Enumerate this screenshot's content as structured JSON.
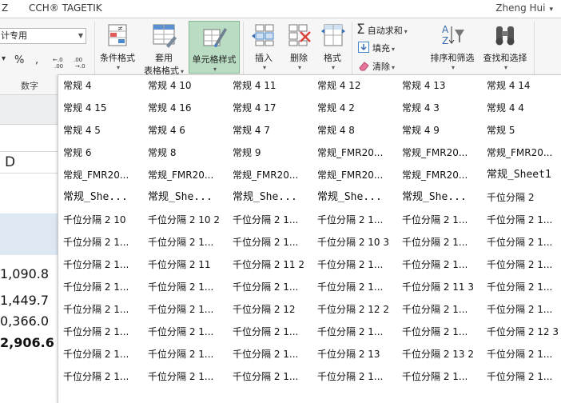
{
  "tabs": [
    "Z",
    "CCH® TAGETIK"
  ],
  "user": {
    "name": "Zheng Hui"
  },
  "ribbon": {
    "number_format_value": "计专用",
    "number_group_label": "数字",
    "number_symbols": {
      "percent": "%",
      "comma": ",",
      "inc_decimal": "←.0 .00",
      "dec_decimal": ".00 →.0"
    },
    "conditional_format": "条件格式",
    "table_format": [
      "套用",
      "表格格式"
    ],
    "cell_styles": "单元格样式",
    "insert": "插入",
    "delete": "删除",
    "format": "格式",
    "autosum": "自动求和",
    "fill": "填充",
    "clear": "清除",
    "sort_filter": "排序和筛选",
    "find_select": "查找和选择"
  },
  "sheet": {
    "column_header": "D",
    "values": [
      "1,090.8",
      "1,449.7",
      "0,366.0",
      "2,906.6"
    ]
  },
  "gallery": {
    "rows": [
      [
        "常规 4",
        "常规 4 10",
        "常规 4 11",
        "常规 4 12",
        "常规 4 13",
        "常规 4 14"
      ],
      [
        "常规 4 15",
        "常规 4 16",
        "常规 4 17",
        "常规 4 2",
        "常规 4 3",
        "常规 4 4"
      ],
      [
        "常规 4 5",
        "常规 4 6",
        "常规 4 7",
        "常规 4 8",
        "常规 4 9",
        "常规 5"
      ],
      [
        "常规 6",
        "常规 8",
        "常规 9",
        "常规_FMR20...",
        "常规_FMR20...",
        "常规_FMR20..."
      ],
      [
        "常规_FMR20...",
        "常规_FMR20...",
        "常规_FMR20...",
        "常规_FMR20...",
        "常规_FMR20...",
        "常规_Sheet1"
      ],
      [
        "常规_She...",
        "常规_She...",
        "常规_She...",
        "常规_She...",
        "常规_She...",
        "千位分隔 2"
      ],
      [
        "千位分隔 2 10",
        "千位分隔 2 10 2",
        "千位分隔 2 1...",
        "千位分隔 2 1...",
        "千位分隔 2 1...",
        "千位分隔 2 1..."
      ],
      [
        "千位分隔 2 1...",
        "千位分隔 2 1...",
        "千位分隔 2 1...",
        "千位分隔 2 10 3",
        "千位分隔 2 1...",
        "千位分隔 2 1..."
      ],
      [
        "千位分隔 2 1...",
        "千位分隔 2 11",
        "千位分隔 2 11 2",
        "千位分隔 2 1...",
        "千位分隔 2 1...",
        "千位分隔 2 1..."
      ],
      [
        "千位分隔 2 1...",
        "千位分隔 2 1...",
        "千位分隔 2 1...",
        "千位分隔 2 1...",
        "千位分隔 2 11 3",
        "千位分隔 2 1..."
      ],
      [
        "千位分隔 2 1...",
        "千位分隔 2 1...",
        "千位分隔 2 12",
        "千位分隔 2 12 2",
        "千位分隔 2 1...",
        "千位分隔 2 1..."
      ],
      [
        "千位分隔 2 1...",
        "千位分隔 2 1...",
        "千位分隔 2 1...",
        "千位分隔 2 1...",
        "千位分隔 2 1...",
        "千位分隔 2 12 3"
      ],
      [
        "千位分隔 2 1...",
        "千位分隔 2 1...",
        "千位分隔 2 1...",
        "千位分隔 2 13",
        "千位分隔 2 13 2",
        "千位分隔 2 1..."
      ],
      [
        "千位分隔 2 1...",
        "千位分隔 2 1...",
        "千位分隔 2 1...",
        "千位分隔 2 1...",
        "千位分隔 2 1...",
        "千位分隔 2 1..."
      ]
    ]
  }
}
